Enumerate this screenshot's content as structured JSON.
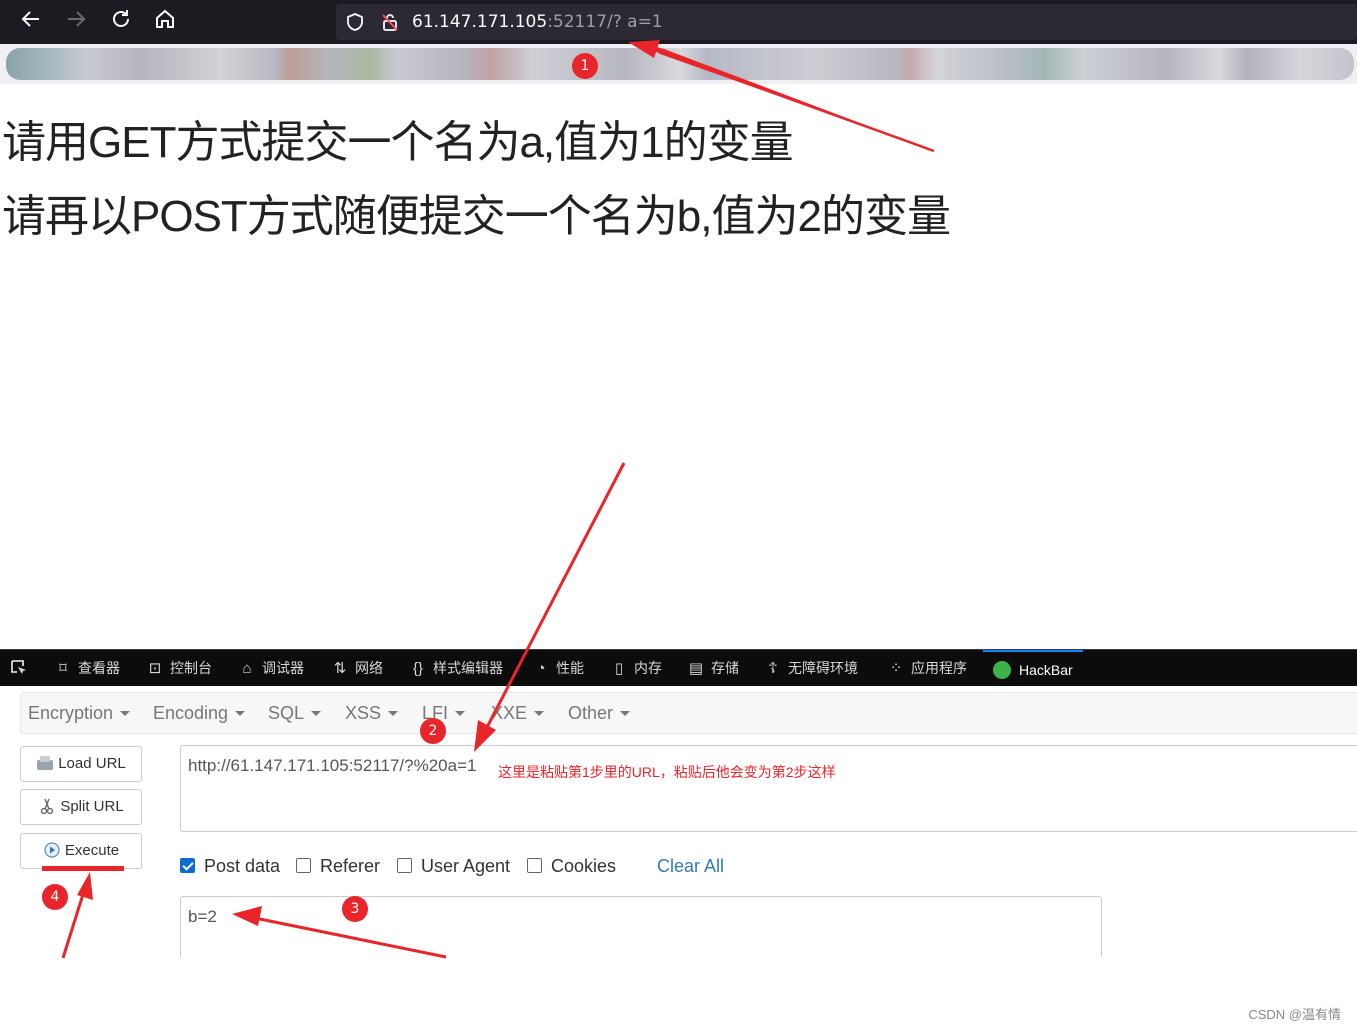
{
  "browser": {
    "url_host": "61.147.171.105",
    "url_rest": ":52117/? a=1"
  },
  "page": {
    "line1": "请用GET方式提交一个名为a,值为1的变量",
    "line2": "请再以POST方式随便提交一个名为b,值为2的变量"
  },
  "devtools": {
    "tabs": [
      {
        "label": "查看器",
        "icon": "inspector-icon"
      },
      {
        "label": "控制台",
        "icon": "console-icon"
      },
      {
        "label": "调试器",
        "icon": "debugger-icon"
      },
      {
        "label": "网络",
        "icon": "network-icon"
      },
      {
        "label": "样式编辑器",
        "icon": "style-editor-icon"
      },
      {
        "label": "性能",
        "icon": "performance-icon"
      },
      {
        "label": "内存",
        "icon": "memory-icon"
      },
      {
        "label": "存储",
        "icon": "storage-icon"
      },
      {
        "label": "无障碍环境",
        "icon": "accessibility-icon"
      },
      {
        "label": "应用程序",
        "icon": "application-icon"
      },
      {
        "label": "HackBar",
        "icon": "hackbar-icon"
      }
    ]
  },
  "hackbar": {
    "menu": [
      "Encryption",
      "Encoding",
      "SQL",
      "XSS",
      "LFI",
      "XXE",
      "Other"
    ],
    "buttons": {
      "load": "Load URL",
      "split": "Split URL",
      "execute": "Execute"
    },
    "url_value": "http://61.147.171.105:52117/?%20a=1",
    "options": {
      "post": "Post data",
      "referer": "Referer",
      "ua": "User Agent",
      "cookies": "Cookies",
      "clear": "Clear All"
    },
    "post_value": "b=2"
  },
  "annotations": {
    "note": "这里是粘贴第1步里的URL，粘贴后他会变为第2步这样",
    "badges": [
      "1",
      "2",
      "3",
      "4"
    ],
    "color": "#e8252a"
  },
  "watermark": "CSDN @温有情"
}
